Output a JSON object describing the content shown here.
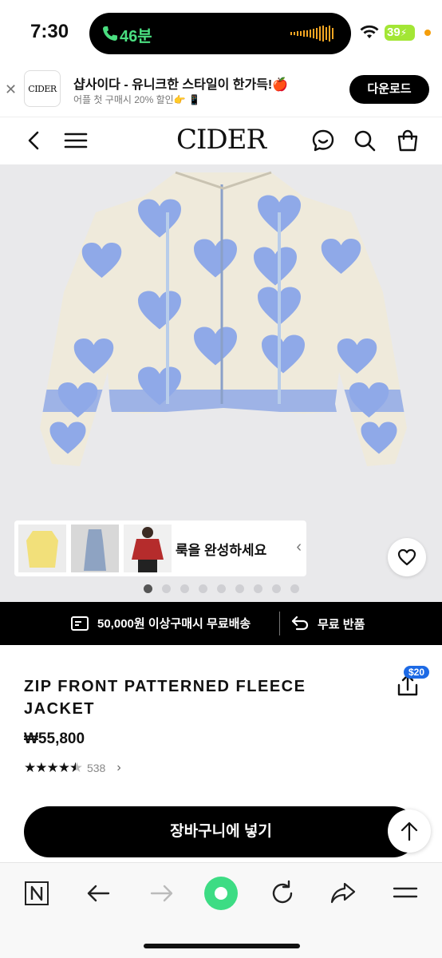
{
  "status_bar": {
    "time": "7:30",
    "call_duration": "46분",
    "battery_level": "39"
  },
  "app_banner": {
    "logo_text": "CIDER",
    "title": "샵사이다 - 유니크한 스타일이 한가득!🍎",
    "subtitle": "어플 첫 구매시 20% 할인👉 📱",
    "download_label": "다운로드"
  },
  "header": {
    "logo": "CIDER"
  },
  "gallery": {
    "look_text": "룩을 완성하세요",
    "dot_count": 9,
    "active_dot": 0
  },
  "promo": {
    "shipping": "50,000원 이상구매시 무료배송",
    "returns": "무료 반품"
  },
  "product": {
    "title": "ZIP FRONT PATTERNED FLEECE JACKET",
    "price": "₩55,800",
    "rating": 4.5,
    "review_count": "538",
    "share_badge": "$20"
  },
  "actions": {
    "add_to_cart": "장바구니에 넣기"
  },
  "colors": {
    "accent": "#1d6ae5",
    "call_green": "#4ade80",
    "heart_blue": "#8fa9e8",
    "fleece": "#efeadb"
  }
}
